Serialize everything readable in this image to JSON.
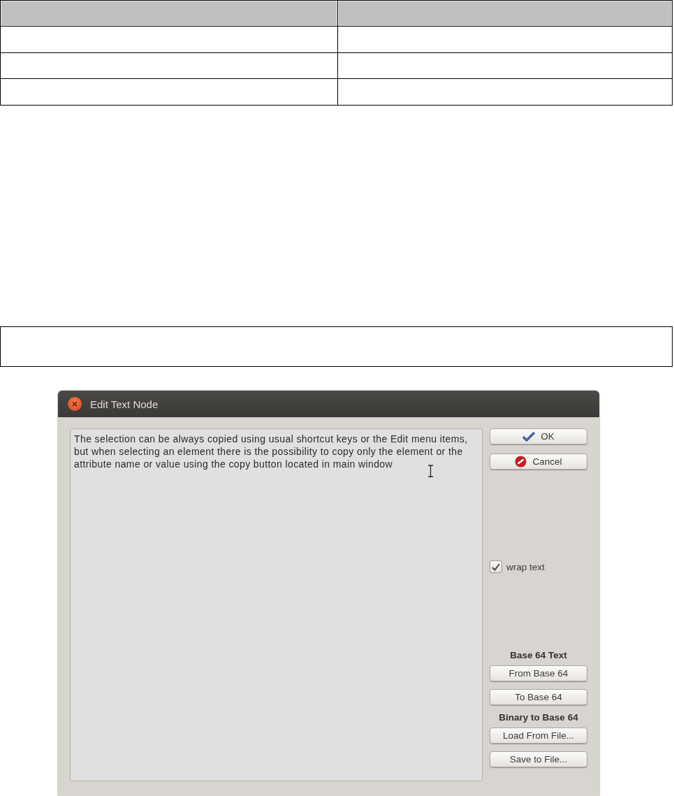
{
  "dialog": {
    "title": "Edit Text Node",
    "text": "The selection can be always copied using usual shortcut keys or the Edit menu items, but when selecting an element there is the possibility to copy only the element or the attribute name or value using the copy button located in main window",
    "ok_button": "OK",
    "cancel_button": "Cancel",
    "wrap_text": {
      "label": "wrap text",
      "checked": true
    },
    "base64_heading": "Base 64 Text",
    "from_base64_button": "From Base 64",
    "to_base64_button": "To Base 64",
    "binary_heading": "Binary to Base 64",
    "load_button": "Load From File...",
    "save_button": "Save to File..."
  }
}
